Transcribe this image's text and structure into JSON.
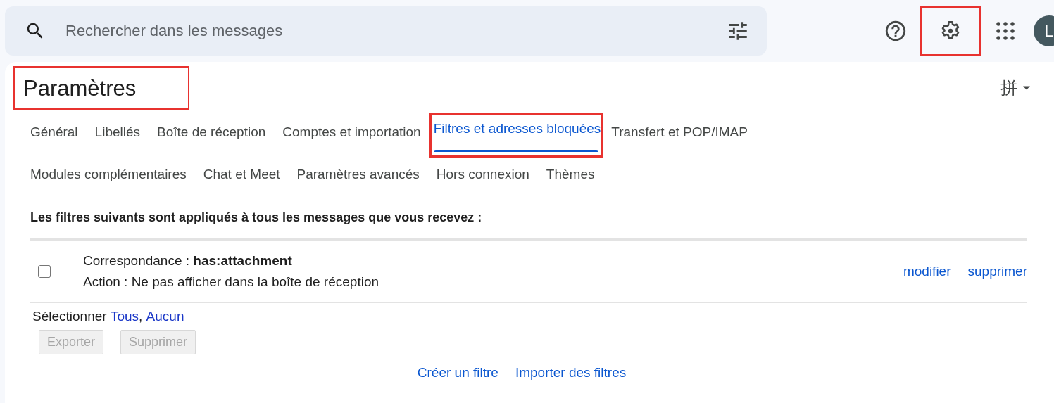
{
  "search": {
    "placeholder": "Rechercher dans les messages"
  },
  "header_icons": [
    {
      "kind": "help",
      "highlighted": false
    },
    {
      "kind": "settings",
      "highlighted": true
    },
    {
      "kind": "apps",
      "highlighted": false
    }
  ],
  "avatar": {
    "initial": "L"
  },
  "title": {
    "text": "Paramètres",
    "highlighted": true
  },
  "input_tools": {
    "label": "拼"
  },
  "tab_rows": [
    [
      {
        "label": "Général",
        "selected": false,
        "highlighted": false
      },
      {
        "label": "Libellés",
        "selected": false,
        "highlighted": false
      },
      {
        "label": "Boîte de réception",
        "selected": false,
        "highlighted": false
      },
      {
        "label": "Comptes et importation",
        "selected": false,
        "highlighted": false
      },
      {
        "label": "Filtres et adresses bloquées",
        "selected": true,
        "highlighted": true
      },
      {
        "label": "Transfert et POP/IMAP",
        "selected": false,
        "highlighted": false
      }
    ],
    [
      {
        "label": "Modules complémentaires",
        "selected": false,
        "highlighted": false
      },
      {
        "label": "Chat et Meet",
        "selected": false,
        "highlighted": false
      },
      {
        "label": "Paramètres avancés",
        "selected": false,
        "highlighted": false
      },
      {
        "label": "Hors connexion",
        "selected": false,
        "highlighted": false
      },
      {
        "label": "Thèmes",
        "selected": false,
        "highlighted": false
      }
    ]
  ],
  "intro": "Les filtres suivants sont appliqués à tous les messages que vous recevez :",
  "filters": [
    {
      "checked": false,
      "match": "Correspondance : **has:attachment**",
      "action": "Action : Ne pas afficher dans la boîte de réception",
      "links": [
        "modifier",
        "supprimer"
      ]
    }
  ],
  "select": {
    "label": "Sélectionner",
    "links": [
      "Tous",
      "Aucun"
    ],
    "separator": ","
  },
  "buttons": [
    {
      "label": "Exporter",
      "disabled": true
    },
    {
      "label": "Supprimer",
      "disabled": true
    }
  ],
  "footer_links": [
    "Créer un filtre",
    "Importer des filtres"
  ]
}
